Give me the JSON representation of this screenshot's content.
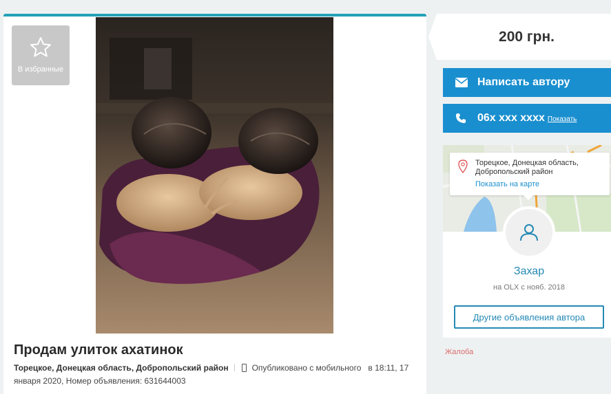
{
  "favorite": {
    "label": "В избранные",
    "icon": "star-outline-icon"
  },
  "ad": {
    "title": "Продам улиток ахатинок",
    "location": "Торецкое, Донецкая область, Добропольский район",
    "published_prefix": "Опубликовано с мобильного",
    "published_at": "в 18:11, 17 января 2020,",
    "ad_number_label": "Номер объявления:",
    "ad_number": "631644003"
  },
  "price": "200 грн.",
  "contact": {
    "message_label": "Написать автору",
    "phone_masked": "06x xxx xxxx",
    "show_label": "Показать"
  },
  "map": {
    "address_line1": "Торецкое, Донецкая область,",
    "address_line2": "Добропольский район",
    "show_on_map": "Показать на карте"
  },
  "seller": {
    "name": "Захар",
    "since": "на OLX с нояб. 2018",
    "other_ads_label": "Другие объявления автора"
  },
  "complaint_label": "Жалоба",
  "colors": {
    "accent": "#1a8fcf",
    "top_border": "#23a1b8",
    "complaint": "#d96b6b"
  }
}
